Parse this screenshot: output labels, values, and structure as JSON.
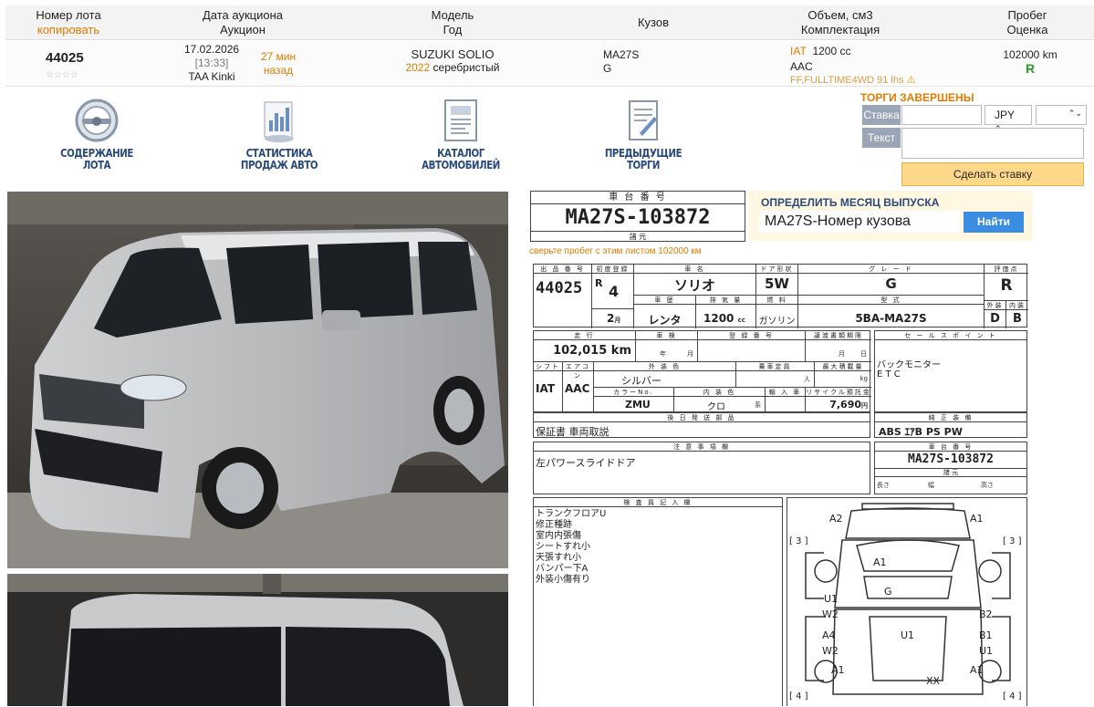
{
  "header": {
    "lot_label": "Номер лота",
    "copy_link": "копировать",
    "date_label": "Дата аукциона",
    "auction_label": "Аукцион",
    "model_label": "Модель",
    "year_label": "Год",
    "body_label": "Кузов",
    "volume_label": "Объем, см3",
    "config_label": "Комплектация",
    "mileage_label": "Пробег",
    "grade_label": "Оценка"
  },
  "lot": {
    "number": "44025",
    "stars": "☆☆☆☆",
    "date": "17.02.2026",
    "time": "[13:33]",
    "auction": "TAA Kinki",
    "ago": "27 мин",
    "ago2": "назад",
    "model": "SUZUKI SOLIO",
    "year": "2022",
    "color": "серебристый",
    "body": "MA27S",
    "body_grade": "G",
    "trans": "IAT",
    "volume": "1200 cc",
    "ac": "AAC",
    "equip": "FF,FULLTIME4WD 91 lhs",
    "mileage": "102000 km",
    "score": "R"
  },
  "nav": [
    {
      "l1": "СОДЕРЖАНИЕ",
      "l2": "ЛОТА"
    },
    {
      "l1": "СТАТИСТИКА",
      "l2": "ПРОДАЖ АВТО"
    },
    {
      "l1": "КАТАЛОГ",
      "l2": "АВТОМОБИЛЕЙ"
    },
    {
      "l1": "ПРЕДЫДУЩИЕ",
      "l2": "ТОРГИ"
    }
  ],
  "bid": {
    "status": "ТОРГИ ЗАВЕРШЕНЫ",
    "stake": "Ставка",
    "currency": "JPY",
    "text": "Текст",
    "button": "Сделать ставку"
  },
  "detect": {
    "title": "ОПРЕДЕЛИТЬ МЕСЯЦ ВЫПУСКА",
    "value": "MA27S-Номер кузова",
    "button": "Найти"
  },
  "sheet": {
    "chassis_title": "車 台 番 号",
    "chassis": "MA27S-103872",
    "chassis_sub": "諸 元",
    "check_note": "сверьте пробег с этим листом 102000 км",
    "h_lot": "出 品 番 号",
    "h_first": "初度登録",
    "h_name": "車 名",
    "h_door": "ドア形状",
    "h_grade": "グ レ ー ド",
    "h_eval": "評価点",
    "lot": "44025",
    "era": "R",
    "year_num": "4",
    "name": "ソリオ",
    "door": "5W",
    "grade": "G",
    "eval": "R",
    "h_cal": "車 歴",
    "h_disp": "排 気 量",
    "h_fuel": "燃 料",
    "h_type": "型 式",
    "h_ext": "外装",
    "h_int": "内装",
    "month": "2",
    "month_u": "月",
    "cal": "レンタ",
    "disp": "1200",
    "disp_u": "cc",
    "fuel": "ガソリン",
    "type": "5BA-MA27S",
    "ext": "D",
    "int": "B",
    "h_run": "走 行",
    "h_insp": "車 検",
    "h_reg": "登 録 番 号",
    "h_expire": "譲渡書類期限",
    "h_sales": "セ ー ル ス ポ イ ン ト",
    "run": "102,015 km",
    "yr": "年",
    "mo": "月",
    "mo2": "月",
    "day": "日",
    "h_shift": "シフト",
    "h_ac": "エアコン",
    "h_color": "外 装 色",
    "h_cap": "乗車定員",
    "h_load": "最大積載量",
    "shift": "IAT",
    "ac": "AAC",
    "color": "シルバー",
    "cap_u": "人",
    "load_u": "kg",
    "h_code": "カラーNo.",
    "h_intc": "内 装 色",
    "h_imp": "輸 入 車",
    "h_recycle": "リサイクル預託金",
    "code": "ZMU",
    "intc": "クロ",
    "intc_u": "系",
    "recycle": "7,690",
    "recycle_u": "円",
    "sales1": "バックモニター",
    "sales2": "E T C",
    "h_parts": "後 日 発 送 部 品",
    "parts": "保証書 車両取説",
    "h_equip": "純 正 装 備",
    "equip": "ABS ｴｱB PS PW",
    "h_notes": "注 意 事 項 欄",
    "notes": "左パワースライドドア",
    "h_chassis2": "車 台 番 号",
    "chassis2": "MA27S-103872",
    "h_spec": "諸 元",
    "len": "長さ",
    "wid": "幅",
    "hei": "高さ",
    "h_inspector": "検 査 員 記 入 欄",
    "inspector": [
      "トランクフロアU",
      "修正種跡",
      "室内内張傷",
      "シートすれ小",
      "天張すれ小",
      "バンパー下A",
      "外装小傷有り"
    ],
    "diagram": {
      "a2": "A2",
      "a1t": "A1",
      "l3": "[ 3 ]",
      "r3": "[ 3 ]",
      "a1m": "A1",
      "g": "G",
      "u1a": "U1",
      "w2a": "W2",
      "b2": "B2",
      "a4": "A4",
      "u1c": "U1",
      "b1": "B1",
      "w2b": "W2",
      "u1b": "U1",
      "a1bl": "A1",
      "a1br": "A1",
      "xx": "XX",
      "l4": "[ 4 ]",
      "r4": "[ 4 ]"
    }
  },
  "colors": {
    "accent": "#e07b00",
    "nav": "#2a4a7a",
    "find_button": "#3a8de0",
    "score_green": "#2a9a2a"
  }
}
